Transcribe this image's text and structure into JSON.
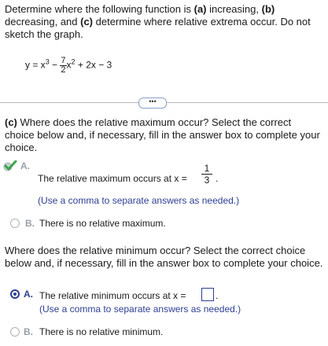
{
  "problem": {
    "prefix": "Determine where the following function is ",
    "a_label": "(a)",
    "a_text": " increasing, ",
    "b_label": "(b)",
    "b_text": " decreasing, and ",
    "c_label": "(c)",
    "c_text": " determine where relative extrema occur. Do not sketch the graph."
  },
  "function": {
    "lhs": "y = x",
    "exp1": "3",
    "minus": " − ",
    "frac_num": "7",
    "frac_den": "2",
    "x": "x",
    "exp2": "2",
    "rest": " + 2x − 3"
  },
  "expand_button": {
    "label": "•••"
  },
  "part_c": {
    "label": "(c)",
    "text": " Where does the relative maximum occur? Select the correct choice below and, if necessary, fill in the answer box to complete your choice."
  },
  "max_options": {
    "a_letter": "A.",
    "a_text": "The relative maximum occurs at x =",
    "a_num": "1",
    "a_den": "3",
    "a_period": ".",
    "a_hint": "(Use a comma to separate answers as needed.)",
    "b_letter": "B.",
    "b_text": "There is no relative maximum."
  },
  "min_question": "Where does the relative minimum occur? Select the correct choice below and, if necessary, fill in the answer box to complete your choice.",
  "min_options": {
    "a_letter": "A.",
    "a_text": "The relative minimum occurs at x =",
    "a_value": "",
    "a_period": ".",
    "a_hint": "(Use a comma to separate answers as needed.)",
    "b_letter": "B.",
    "b_text": "There is no relative minimum."
  },
  "colors": {
    "accent": "#2d3f93",
    "check": "#3aa54a",
    "muted": "#9aa0a8"
  }
}
